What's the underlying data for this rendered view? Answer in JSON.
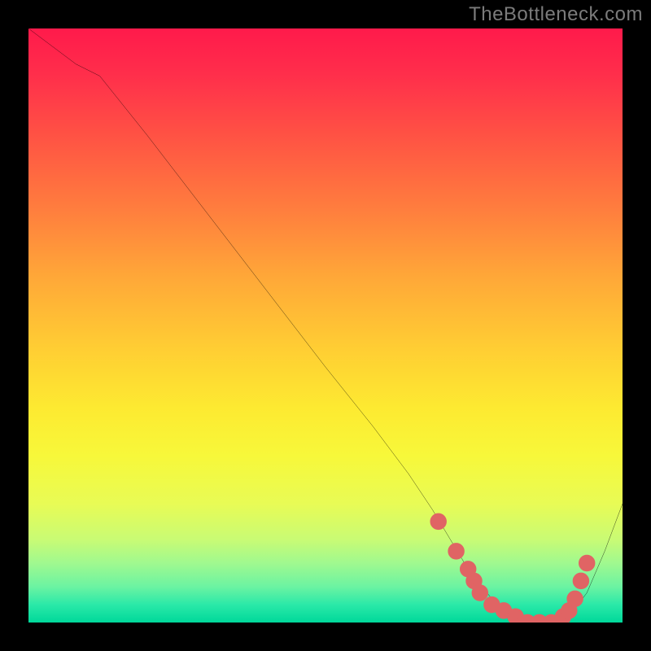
{
  "watermark": "TheBottleneck.com",
  "colors": {
    "frame_bg": "#000000",
    "curve_stroke": "#000000",
    "dot_fill": "#e06464",
    "gradient_top": "#ff1a4b",
    "gradient_bottom": "#00d89a"
  },
  "chart_data": {
    "type": "line",
    "title": "",
    "xlabel": "",
    "ylabel": "",
    "xlim": [
      0,
      100
    ],
    "ylim": [
      0,
      100
    ],
    "grid": false,
    "legend": false,
    "series": [
      {
        "name": "curve",
        "x": [
          0,
          4,
          8,
          12,
          20,
          30,
          40,
          50,
          58,
          64,
          68,
          71,
          74,
          78,
          82,
          86,
          88,
          91,
          94,
          97,
          100
        ],
        "y": [
          100,
          97,
          94,
          92,
          82,
          69,
          56,
          43,
          33,
          25,
          19,
          14,
          9,
          4,
          1,
          0,
          0,
          1,
          5,
          12,
          20
        ]
      }
    ],
    "markers": [
      {
        "x": 69,
        "y": 17
      },
      {
        "x": 72,
        "y": 12
      },
      {
        "x": 74,
        "y": 9
      },
      {
        "x": 75,
        "y": 7
      },
      {
        "x": 76,
        "y": 5
      },
      {
        "x": 78,
        "y": 3
      },
      {
        "x": 80,
        "y": 2
      },
      {
        "x": 82,
        "y": 1
      },
      {
        "x": 84,
        "y": 0
      },
      {
        "x": 86,
        "y": 0
      },
      {
        "x": 88,
        "y": 0
      },
      {
        "x": 90,
        "y": 1
      },
      {
        "x": 91,
        "y": 2
      },
      {
        "x": 92,
        "y": 4
      },
      {
        "x": 93,
        "y": 7
      },
      {
        "x": 94,
        "y": 10
      }
    ]
  }
}
